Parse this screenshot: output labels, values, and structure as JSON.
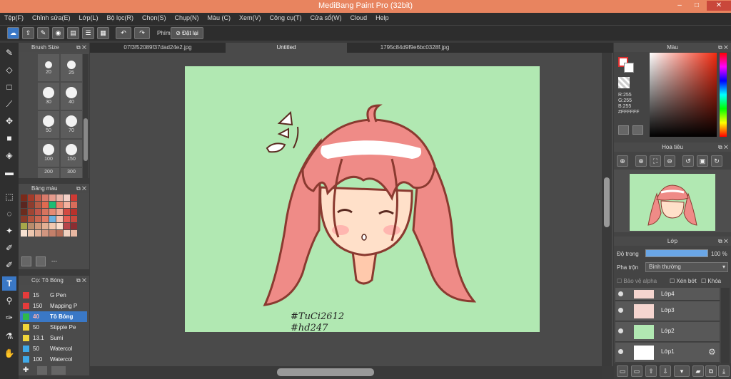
{
  "window": {
    "title": "MediBang Paint Pro (32bit)",
    "minimize": "‒",
    "maximize": "□",
    "close": "✕"
  },
  "menu": [
    "Tệp(F)",
    "Chỉnh sửa(E)",
    "Lớp(L)",
    "Bộ lọc(R)",
    "Chọn(S)",
    "Chụp(N)",
    "Màu (C)",
    "Xem(V)",
    "Công cụ(T)",
    "Cửa sổ(W)",
    "Cloud",
    "Help"
  ],
  "toolbar": {
    "phim_label": "Phím",
    "reset_label": "Đặt lại"
  },
  "brush_panel": {
    "title": "Brush Size",
    "sizes": [
      "20",
      "25",
      "30",
      "40",
      "50",
      "70",
      "100",
      "150",
      "200",
      "300"
    ]
  },
  "palette_panel": {
    "title": "Bảng màu",
    "dots": "---"
  },
  "brush_list": {
    "title": "Cọ: Tô Bóng",
    "items": [
      {
        "size": "15",
        "name": "G Pen",
        "color": "#e53b3b"
      },
      {
        "size": "150",
        "name": "Mapping P",
        "color": "#e53b3b"
      },
      {
        "size": "40",
        "name": "Tô Bóng",
        "color": "#2fb84a",
        "selected": true
      },
      {
        "size": "50",
        "name": "Stipple Pe",
        "color": "#f0d53a"
      },
      {
        "size": "13.1",
        "name": "Sumi",
        "color": "#f0d53a"
      },
      {
        "size": "50",
        "name": "Watercol",
        "color": "#3fa9e8"
      },
      {
        "size": "100",
        "name": "Watercol",
        "color": "#3fa9e8"
      }
    ]
  },
  "tabs": [
    "07f3f52089f37dad24e2.jpg",
    "Untitled",
    "1795c84d9f9e6bc0328f.jpg"
  ],
  "artwork": {
    "line1": "#TuCi2612",
    "line2": "#hd247"
  },
  "color_panel": {
    "title": "Màu",
    "r": "R:255",
    "g": "G:255",
    "b": "B:255",
    "hex": "#FFFFFF"
  },
  "navigator": {
    "title": "Hoa tiêu"
  },
  "layer_panel": {
    "title": "Lớp",
    "opacity_label": "Độ trong",
    "opacity_value": "100 %",
    "blend_label": "Pha trộn",
    "blend_value": "Bình thường",
    "protect_alpha": "Bảo vệ alpha",
    "clipping": "Xén bớt",
    "lock": "Khóa",
    "layers": [
      "Lớp4",
      "Lớp3",
      "Lớp2",
      "Lớp1"
    ]
  }
}
